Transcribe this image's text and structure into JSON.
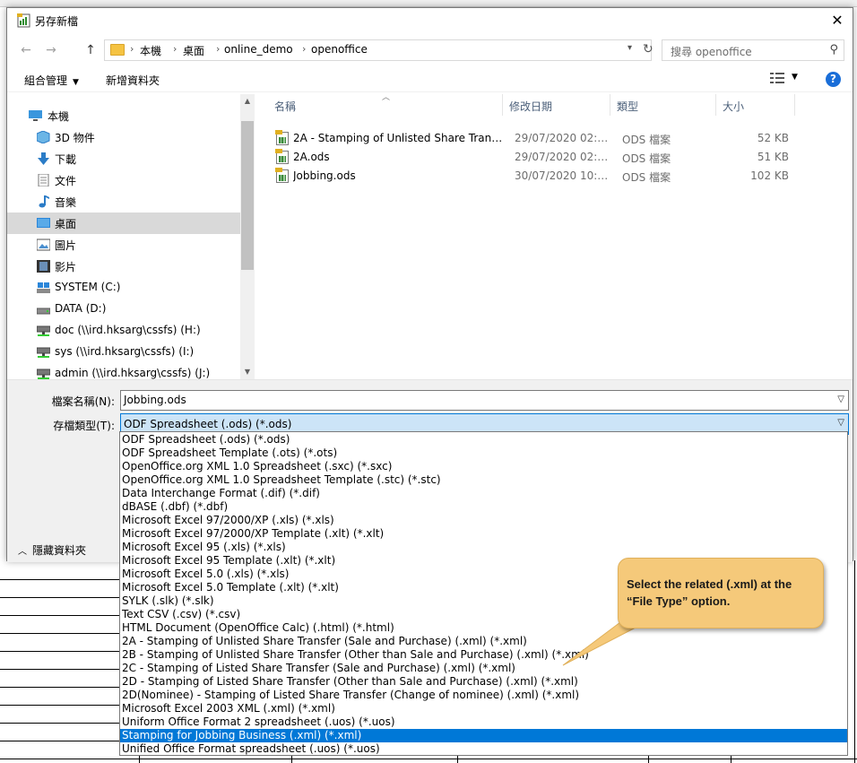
{
  "dialog": {
    "title": "另存新檔",
    "close_label": "✕"
  },
  "nav": {
    "back_label": "←",
    "forward_label": "→",
    "up_label": "↑",
    "breadcrumbs": [
      "本機",
      "桌面",
      "online_demo",
      "openoffice"
    ],
    "search_placeholder": "搜尋 openoffice"
  },
  "commands": {
    "organize_label": "組合管理",
    "new_folder_label": "新增資料夾"
  },
  "tree": {
    "items": [
      {
        "label": "本機",
        "icon": "pc-icon"
      },
      {
        "label": "3D 物件",
        "icon": "3d-objects-icon"
      },
      {
        "label": "下載",
        "icon": "download-icon"
      },
      {
        "label": "文件",
        "icon": "document-icon"
      },
      {
        "label": "音樂",
        "icon": "music-icon"
      },
      {
        "label": "桌面",
        "icon": "desktop-icon"
      },
      {
        "label": "圖片",
        "icon": "pictures-icon"
      },
      {
        "label": "影片",
        "icon": "videos-icon"
      },
      {
        "label": "SYSTEM (C:)",
        "icon": "drive-icon"
      },
      {
        "label": "DATA (D:)",
        "icon": "drive-icon"
      },
      {
        "label": "doc (\\\\ird.hksarg\\cssfs) (H:)",
        "icon": "network-drive-icon"
      },
      {
        "label": "sys (\\\\ird.hksarg\\cssfs) (I:)",
        "icon": "network-drive-icon"
      },
      {
        "label": "admin (\\\\ird.hksarg\\cssfs) (J:)",
        "icon": "network-drive-icon"
      }
    ],
    "selected": "桌面"
  },
  "filelist": {
    "columns": [
      "名稱",
      "修改日期",
      "類型",
      "大小"
    ],
    "files": [
      {
        "name": "2A - Stamping of Unlisted Share Transf...",
        "date": "29/07/2020 02:2...",
        "type": "ODS 檔案",
        "size": "52 KB"
      },
      {
        "name": "2A.ods",
        "date": "29/07/2020 02:4...",
        "type": "ODS 檔案",
        "size": "51 KB"
      },
      {
        "name": "Jobbing.ods",
        "date": "30/07/2020 10:1...",
        "type": "ODS 檔案",
        "size": "102 KB"
      }
    ]
  },
  "form": {
    "filename_label": "檔案名稱(N):",
    "filename_value": "Jobbing.ods",
    "filetype_label": "存檔類型(T):",
    "filetype_value": "ODF Spreadsheet (.ods) (*.ods)",
    "hide_folders_label": "隱藏資料夾"
  },
  "filetype_options": [
    "ODF Spreadsheet (.ods) (*.ods)",
    "ODF Spreadsheet Template (.ots) (*.ots)",
    "OpenOffice.org XML 1.0 Spreadsheet (.sxc) (*.sxc)",
    "OpenOffice.org XML 1.0 Spreadsheet Template (.stc) (*.stc)",
    "Data Interchange Format (.dif) (*.dif)",
    "dBASE (.dbf) (*.dbf)",
    "Microsoft Excel 97/2000/XP (.xls) (*.xls)",
    "Microsoft Excel 97/2000/XP Template (.xlt) (*.xlt)",
    "Microsoft Excel 95 (.xls) (*.xls)",
    "Microsoft Excel 95 Template (.xlt) (*.xlt)",
    "Microsoft Excel 5.0 (.xls) (*.xls)",
    "Microsoft Excel 5.0 Template (.xlt) (*.xlt)",
    "SYLK (.slk) (*.slk)",
    "Text CSV (.csv) (*.csv)",
    "HTML Document (OpenOffice Calc) (.html) (*.html)",
    "2A - Stamping of Unlisted Share Transfer (Sale and Purchase) (.xml) (*.xml)",
    "2B - Stamping of Unlisted Share Transfer (Other than Sale and Purchase) (.xml) (*.xml)",
    "2C - Stamping of Listed Share Transfer (Sale and Purchase) (.xml) (*.xml)",
    "2D - Stamping of Listed Share Transfer (Other than Sale and Purchase) (.xml) (*.xml)",
    "2D(Nominee) - Stamping of Listed Share Transfer (Change of nominee) (.xml) (*.xml)",
    "Microsoft Excel 2003 XML (.xml) (*.xml)",
    "Uniform Office Format 2 spreadsheet (.uos) (*.uos)",
    "Stamping for Jobbing Business (.xml) (*.xml)",
    "Unified Office Format spreadsheet (.uos) (*.uos)"
  ],
  "selected_option_index": 22,
  "callout": {
    "text": "Select the related (.xml) at the “File Type” option."
  },
  "colors": {
    "accent": "#0078d7",
    "selection": "#cce4f7",
    "callout": "#f5c97a"
  }
}
